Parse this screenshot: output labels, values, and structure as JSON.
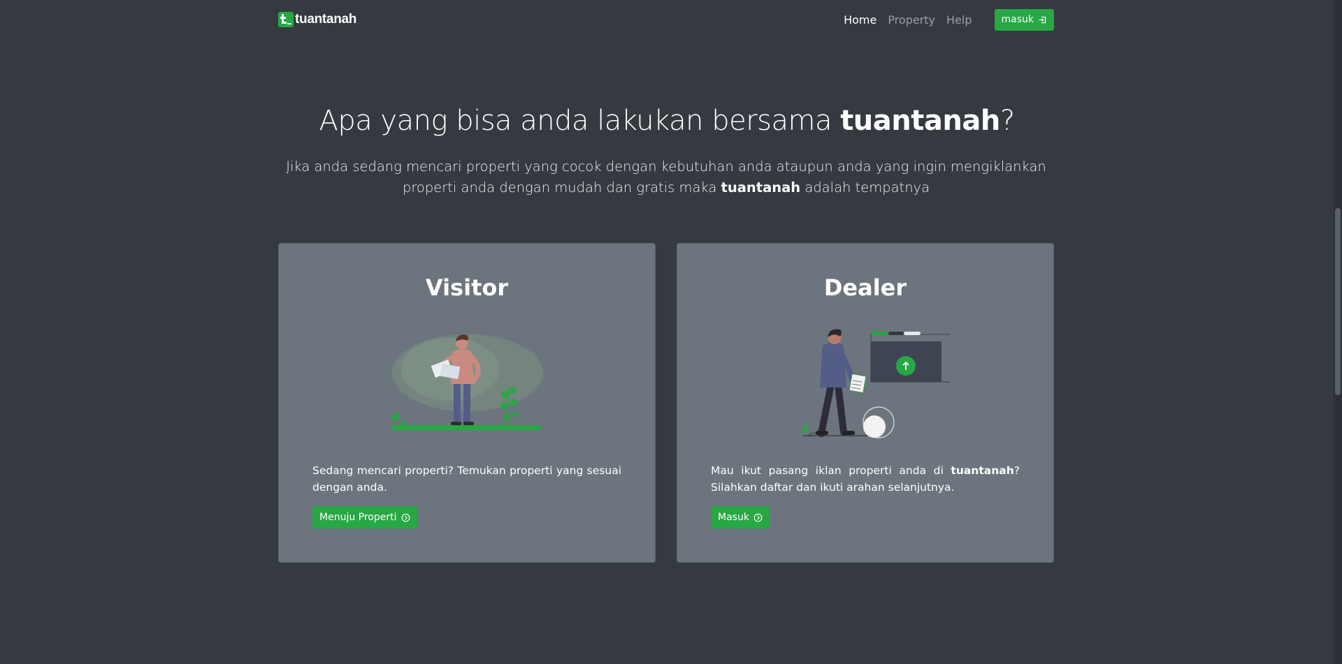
{
  "nav": {
    "brand": "tuantanah",
    "links": [
      "Home",
      "Property",
      "Help"
    ],
    "login_label": "masuk"
  },
  "hero": {
    "title_prefix": "Apa yang bisa anda lakukan bersama ",
    "title_brand": "tuantanah",
    "title_suffix": "?",
    "sub_part1": "Jika anda sedang mencari properti yang cocok dengan kebutuhan anda ataupun anda yang ingin mengiklankan properti anda dengan mudah dan gratis maka ",
    "sub_brand": "tuantanah",
    "sub_part2": " adalah tempatnya"
  },
  "cards": [
    {
      "title": "Visitor",
      "text": "Sedang mencari properti? Temukan properti yang sesuai dengan anda.",
      "button": "Menuju Properti"
    },
    {
      "title": "Dealer",
      "text_part1": "Mau ikut pasang iklan properti anda di ",
      "text_brand": "tuantanah",
      "text_part2": "? Silahkan daftar dan ikuti arahan selanjutnya.",
      "button": "Masuk"
    }
  ],
  "colors": {
    "background": "#343a40",
    "card": "#6c757d",
    "accent": "#28a745"
  },
  "icons": {
    "login": "login-icon",
    "arrow": "arrow-right-circle-icon"
  }
}
